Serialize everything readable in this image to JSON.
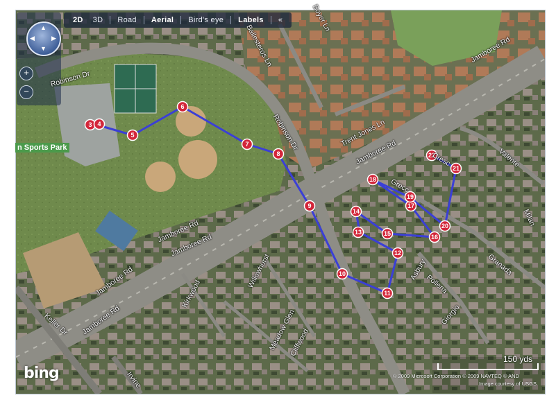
{
  "toolbar": {
    "items": [
      "2D",
      "3D",
      "Road",
      "Aerial",
      "Bird's eye",
      "Labels"
    ],
    "active": [
      "2D",
      "Aerial",
      "Labels"
    ],
    "collapse": "«"
  },
  "zoom": {
    "in": "+",
    "out": "−"
  },
  "compass": {
    "arrows": [
      "▲",
      "▼",
      "◀",
      "▶"
    ]
  },
  "labels": {
    "robinson_dr_1": "Robinson Dr",
    "robinson_dr_2": "Robinson Dr",
    "ballesteros": "Ballesteros Ln",
    "boyer": "Boyer Ln",
    "trent_jones": "Trent Jones Ln",
    "jamboree_1": "Jamboree Rd",
    "jamboree_2": "Jamboree Rd",
    "jamboree_3": "Jamboree Rd",
    "jamboree_4": "Jamboree Rd",
    "jamboree_5": "Jamboree Rd",
    "jamboree_6": "Jamboree Rd",
    "sports_park": "n Sports Park",
    "valente": "Valente",
    "milan": "Milan",
    "granada": "Granada",
    "asbury": "Asbury",
    "pollena": "Pollena",
    "giorgio": "Giorgio",
    "grecc": "Grecc",
    "kirkwood": "Kirkwood",
    "willowhurst": "Willowhurst",
    "meadow_glen": "Meadow Glen",
    "cliffwood": "Cliffwood",
    "keller": "Keller Dr",
    "irvine": "Irvine",
    "cresc": "Cresc"
  },
  "route": {
    "color": "#3b3fd6",
    "waypoints": [
      "3",
      "4",
      "5",
      "6",
      "7",
      "8",
      "9",
      "10",
      "11",
      "12",
      "13",
      "14",
      "15",
      "16",
      "17",
      "18",
      "19",
      "20",
      "21",
      "22"
    ]
  },
  "scale": {
    "label": "150 yds"
  },
  "copyright": "© 2009 Microsoft Corporation   © 2009 NAVTEQ   © AND",
  "courtesy": "Image courtesy of USGS",
  "brand": "bing"
}
